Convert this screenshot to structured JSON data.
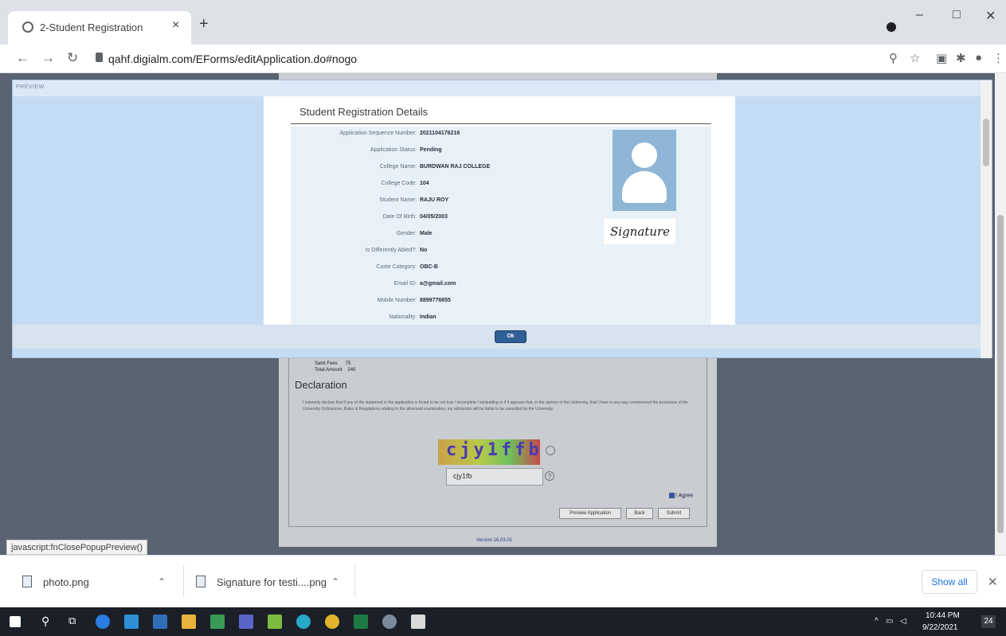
{
  "browser": {
    "tab_title": "2-Student Registration",
    "tab_close": "×",
    "new_tab": "+",
    "url": "qahf.digialm.com/EForms/editApplication.do#nogo",
    "window_controls": [
      "–",
      "□",
      "✕"
    ]
  },
  "preview_panel": {
    "header": "PREVIEW",
    "header_close": "✕",
    "dialog_title": "Student Registration Details",
    "ok_label": "Ok",
    "signature_text": "Signature",
    "details": [
      {
        "label": "Application Sequence Number:",
        "value": "2021104176216"
      },
      {
        "label": "Application Status:",
        "value": "Pending"
      },
      {
        "label": "College Name:",
        "value": "BURDWAN RAJ COLLEGE"
      },
      {
        "label": "College Code:",
        "value": "104"
      },
      {
        "label": "Student Name:",
        "value": "RAJU ROY"
      },
      {
        "label": "Date Of Birth:",
        "value": "04/05/2003"
      },
      {
        "label": "Gender:",
        "value": "Male"
      },
      {
        "label": "Is Differently Abled?:",
        "value": "No"
      },
      {
        "label": "Caste Category:",
        "value": "OBC-B"
      },
      {
        "label": "Email ID:",
        "value": "a@gmail.com"
      },
      {
        "label": "Mobile Number:",
        "value": "8899776655"
      },
      {
        "label": "Nationality:",
        "value": "Indian"
      }
    ]
  },
  "form": {
    "fees": [
      {
        "label": "Saint Fees",
        "value": "75"
      },
      {
        "label": "Total Amount",
        "value": "240"
      }
    ],
    "declaration_title": "Declaration",
    "declaration_text": "I solemnly declare that if any of the statement in the application is found to be not true / incomplete / misleading or if it appears that, in the opinion of the University, that I have in any way contravened the provisions of the University Ordinances, Rules & Regulations relating to the aforesaid examination, my admission will be liable to be cancelled by the University.",
    "captcha_text": "cjy1ffb",
    "captcha_input": "cjy1fb",
    "agree_label": "I Agree",
    "buttons": [
      "Preview Application",
      "Back",
      "Submit"
    ],
    "version": "Version 16.03.01"
  },
  "status_url": "javascript:fnClosePopupPreview()",
  "downloads": {
    "items": [
      {
        "name": "photo.png"
      },
      {
        "name": "Signature for testi....png"
      }
    ],
    "show_all": "Show all",
    "close": "✕"
  },
  "taskbar": {
    "time": "10:44 PM",
    "date": "9/22/2021",
    "notifications": "24"
  }
}
